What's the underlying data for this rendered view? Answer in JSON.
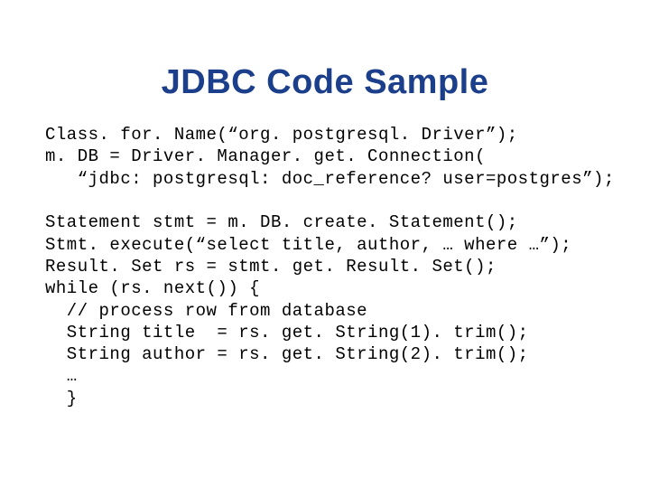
{
  "title": "JDBC  Code Sample",
  "code": {
    "l1": "Class. for. Name(“org. postgresql. Driver”);",
    "l2": "m. DB = Driver. Manager. get. Connection(",
    "l3": "   “jdbc: postgresql: doc_reference? user=postgres”);",
    "l4": "",
    "l5": "Statement stmt = m. DB. create. Statement();",
    "l6": "Stmt. execute(“select title, author, … where …”);",
    "l7": "Result. Set rs = stmt. get. Result. Set();",
    "l8": "while (rs. next()) {",
    "l9": "  // process row from database",
    "l10": "  String title  = rs. get. String(1). trim();",
    "l11": "  String author = rs. get. String(2). trim();",
    "l12": "  …",
    "l13": "  }"
  }
}
